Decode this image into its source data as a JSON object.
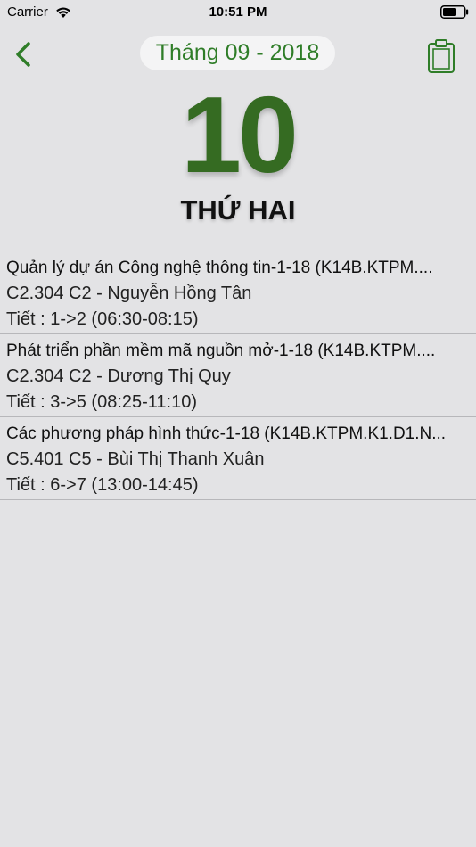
{
  "status_bar": {
    "carrier": "Carrier",
    "time": "10:51 PM"
  },
  "nav": {
    "month_label": "Tháng 09 - 2018",
    "back_icon": "chevron-left-icon",
    "clipboard_icon": "clipboard-icon"
  },
  "day": {
    "number": "10",
    "weekday": "THỨ HAI"
  },
  "schedule": [
    {
      "title": "Quản lý dự án Công nghệ thông tin-1-18 (K14B.KTPM....",
      "room": "C2.304 C2 - Nguyễn Hồng Tân",
      "period": "Tiết : 1->2 (06:30-08:15)"
    },
    {
      "title": "Phát triển phần mềm mã nguồn mở-1-18 (K14B.KTPM....",
      "room": "C2.304 C2 - Dương Thị Quy",
      "period": "Tiết : 3->5 (08:25-11:10)"
    },
    {
      "title": "Các phương pháp hình thức-1-18 (K14B.KTPM.K1.D1.N...",
      "room": "C5.401 C5 - Bùi Thị Thanh Xuân",
      "period": "Tiết : 6->7 (13:00-14:45)"
    }
  ],
  "colors": {
    "accent_green": "#2f7d28",
    "day_green": "#356b22",
    "background": "#e3e3e5"
  }
}
